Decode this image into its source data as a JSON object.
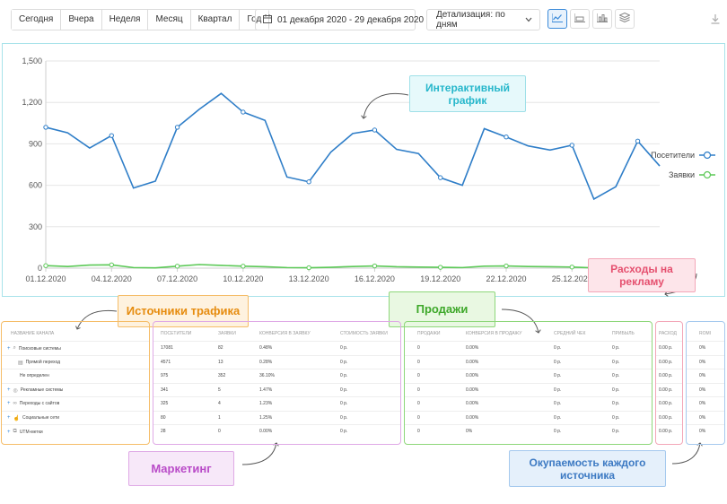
{
  "toolbar": {
    "periods": [
      "Сегодня",
      "Вчера",
      "Неделя",
      "Месяц",
      "Квартал",
      "Год"
    ],
    "date_range": "01 декабря 2020 - 29 декабря 2020",
    "detail": "Детализация: по дням",
    "icons": [
      "calendar-icon",
      "chevron-down-icon",
      "line-chart-icon",
      "area-chart-icon",
      "bar-chart-icon",
      "layers-icon",
      "download-icon"
    ]
  },
  "chart_data": {
    "type": "line",
    "x_tick_labels": [
      "01.12.2020",
      "04.12.2020",
      "07.12.2020",
      "10.12.2020",
      "13.12.2020",
      "16.12.2020",
      "19.12.2020",
      "22.12.2020",
      "25.12.2020"
    ],
    "y_tick_labels": [
      "1,500",
      "1,200",
      "900",
      "600",
      "300",
      "0"
    ],
    "ylim": [
      0,
      1500
    ],
    "x": [
      1,
      2,
      3,
      4,
      5,
      6,
      7,
      8,
      9,
      10,
      11,
      12,
      13,
      14,
      15,
      16,
      17,
      18,
      19,
      20,
      21,
      22,
      23,
      24,
      25,
      26,
      27,
      28,
      29
    ],
    "series": [
      {
        "name": "Посетители",
        "color": "#2f7ec8",
        "values": [
          1020,
          980,
          870,
          960,
          580,
          630,
          1020,
          1150,
          1265,
          1130,
          1070,
          660,
          625,
          840,
          975,
          1000,
          860,
          830,
          655,
          600,
          1010,
          950,
          885,
          855,
          890,
          500,
          590,
          920,
          740
        ]
      },
      {
        "name": "Заявки",
        "color": "#5cc957",
        "values": [
          18,
          12,
          22,
          24,
          4,
          2,
          14,
          26,
          20,
          14,
          10,
          4,
          3,
          6,
          12,
          16,
          10,
          8,
          6,
          4,
          14,
          16,
          12,
          10,
          8,
          2,
          4,
          6,
          4
        ]
      }
    ],
    "legend_position": "right",
    "grid": true
  },
  "callouts": {
    "interactive": [
      "Интерактивный",
      "график"
    ],
    "sources": "Источники трафика",
    "sales": "Продажи",
    "ads": [
      "Расходы на",
      "рекламу"
    ],
    "marketing": "Маркетинг",
    "roi": [
      "Окупаемость каждого",
      "источника"
    ]
  },
  "table": {
    "headers": {
      "name": "Название канала",
      "marketing": [
        "Посетители",
        "Заявки",
        "Конверсия в заявку",
        "Стоимость заявки"
      ],
      "sales": [
        "Продажи",
        "Конверсия в продажу",
        "Средний чек",
        "Прибыль"
      ],
      "ads": "Расход",
      "roi": "ROMI"
    },
    "rows": [
      {
        "name": "Поисковые системы",
        "icon": "search-icon",
        "expandable": true,
        "marketing": [
          "17081",
          "82",
          "0.48%",
          "0 р."
        ],
        "sales": [
          "0",
          "0.00%",
          "0 р.",
          "0 р."
        ],
        "ads": "0.00 р.",
        "roi": "0%"
      },
      {
        "name": "Прямой переход",
        "icon": "document-icon",
        "expandable": false,
        "marketing": [
          "4571",
          "13",
          "0.28%",
          "0 р."
        ],
        "sales": [
          "0",
          "0.00%",
          "0 р.",
          "0 р."
        ],
        "ads": "0.00 р.",
        "roi": "0%"
      },
      {
        "name": "Не определен",
        "icon": "",
        "expandable": false,
        "marketing": [
          "975",
          "352",
          "36.10%",
          "0 р."
        ],
        "sales": [
          "0",
          "0.00%",
          "0 р.",
          "0 р."
        ],
        "ads": "0.00 р.",
        "roi": "0%"
      },
      {
        "name": "Рекламные системы",
        "icon": "ads-icon",
        "expandable": true,
        "marketing": [
          "341",
          "5",
          "1.47%",
          "0 р."
        ],
        "sales": [
          "0",
          "0.00%",
          "0 р.",
          "0 р."
        ],
        "ads": "0.00 р.",
        "roi": "0%"
      },
      {
        "name": "Переходы с сайтов",
        "icon": "link-icon",
        "expandable": true,
        "marketing": [
          "325",
          "4",
          "1.23%",
          "0 р."
        ],
        "sales": [
          "0",
          "0.00%",
          "0 р.",
          "0 р."
        ],
        "ads": "0.00 р.",
        "roi": "0%"
      },
      {
        "name": "Социальные сети",
        "icon": "like-icon",
        "expandable": true,
        "marketing": [
          "80",
          "1",
          "1.25%",
          "0 р."
        ],
        "sales": [
          "0",
          "0.00%",
          "0 р.",
          "0 р."
        ],
        "ads": "0.00 р.",
        "roi": "0%"
      },
      {
        "name": "UTM-метки",
        "icon": "utm-icon",
        "expandable": true,
        "marketing": [
          "28",
          "0",
          "0.00%",
          "0 р."
        ],
        "sales": [
          "0",
          "0%",
          "0 р.",
          "0 р."
        ],
        "ads": "0.00 р.",
        "roi": "0%"
      }
    ]
  }
}
